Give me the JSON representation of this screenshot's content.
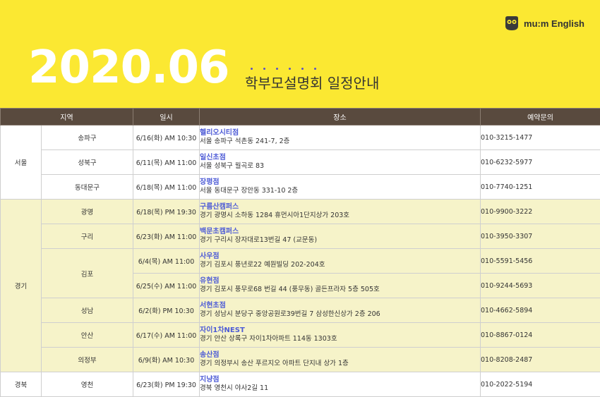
{
  "brand": {
    "logo_text": "mu:m English",
    "logo_icon": "owl-icon"
  },
  "header": {
    "year_month": "2020.06",
    "subtitle": "학부모설명회 일정안내"
  },
  "colors": {
    "banner": "#fbe832",
    "header_row": "#594a3e",
    "place_name": "#4d5bd6",
    "gyeonggi_row": "#f6f3c9",
    "dots": "#5b52c8"
  },
  "table": {
    "headers": [
      "지역",
      "일시",
      "장소",
      "예약문의"
    ],
    "regions": [
      "서울",
      "경기",
      "경북"
    ],
    "rows": [
      {
        "district": "송파구",
        "date": "6/16(화) AM 10:30",
        "place": "헬리오시티점",
        "address": "서울 송파구 석촌동 241-7, 2층",
        "phone": "010-3215-1477"
      },
      {
        "district": "성북구",
        "date": "6/11(목) AM 11:00",
        "place": "일신초점",
        "address": "서울 성북구 월곡로 83",
        "phone": "010-6232-5977"
      },
      {
        "district": "동대문구",
        "date": "6/18(목) AM 11:00",
        "place": "장평점",
        "address": "서울 동대문구 장안동 331-10 2층",
        "phone": "010-7740-1251"
      },
      {
        "district": "광명",
        "date": "6/18(목) PM 19:30",
        "place": "구름산캠퍼스",
        "address": "경기 광명시 소하동 1284 휴먼시아1단지상가 203호",
        "phone": "010-9900-3222"
      },
      {
        "district": "구리",
        "date": "6/23(화) AM 11:00",
        "place": "백문초캠퍼스",
        "address": "경기 구리시 장자대로13번길 47 (교문동)",
        "phone": "010-3950-3307"
      },
      {
        "district": "김포",
        "date": "6/4(목) AM 11:00",
        "place": "사우점",
        "address": "경기 김포시 풍년로22 예원빌딩 202-204호",
        "phone": "010-5591-5456"
      },
      {
        "district": "",
        "date": "6/25(수) AM 11:00",
        "place": "유현점",
        "address": "경기 김포시 풍무로68 번길 44 (풍무동) 골든프라자 5층 505호",
        "phone": "010-9244-5693"
      },
      {
        "district": "성남",
        "date": "6/2(화) PM 10:30",
        "place": "서현초점",
        "address": "경기 성남시 분당구 중앙공원로39번길 7 삼성한신상가 2층 206",
        "phone": "010-4662-5894"
      },
      {
        "district": "안산",
        "date": "6/17(수) AM 11:00",
        "place": "자이1차NEST",
        "address": "경기 안산 상록구 자이1차아파트 114동 1303호",
        "phone": "010-8867-0124"
      },
      {
        "district": "의정부",
        "date": "6/9(화) AM 10:30",
        "place": "송산점",
        "address": "경기 의정부시  송산 푸르지오 아파트 단지내 상가 1층",
        "phone": "010-8208-2487"
      },
      {
        "district": "영천",
        "date": "6/23(화) PM 19:30",
        "place": "지냥점",
        "address": "경북 영천시 야사2길 11",
        "phone": "010-2022-5194"
      }
    ]
  }
}
